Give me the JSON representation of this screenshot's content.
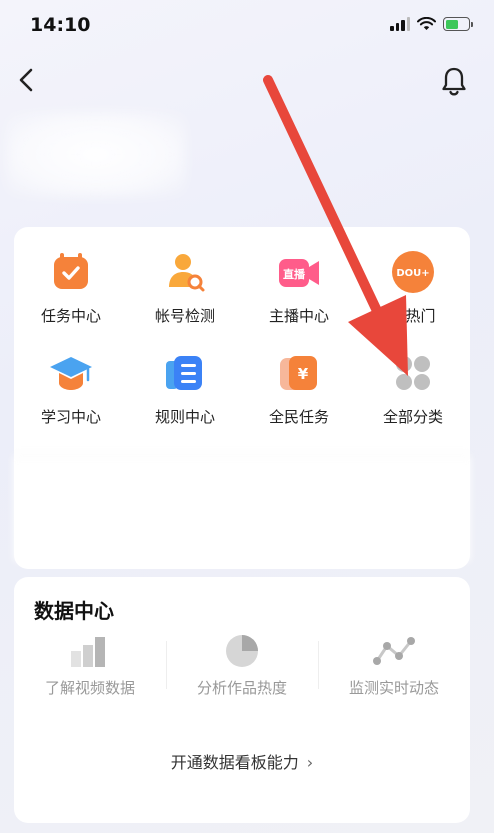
{
  "status": {
    "time": "14:10"
  },
  "services": {
    "items": [
      {
        "label": "任务中心",
        "icon": "task-icon"
      },
      {
        "label": "帐号检测",
        "icon": "account-check-icon"
      },
      {
        "label": "主播中心",
        "icon": "streamer-icon",
        "badge": "直播"
      },
      {
        "label": "上热门",
        "icon": "dou-plus-icon",
        "badge": "DOU+"
      },
      {
        "label": "学习中心",
        "icon": "graduation-cap-icon"
      },
      {
        "label": "规则中心",
        "icon": "rules-icon"
      },
      {
        "label": "全民任务",
        "icon": "yuan-task-icon",
        "badge": "¥"
      },
      {
        "label": "全部分类",
        "icon": "all-categories-icon"
      }
    ]
  },
  "data_center": {
    "title": "数据中心",
    "items": [
      {
        "label": "了解视频数据",
        "icon": "bar-chart-icon"
      },
      {
        "label": "分析作品热度",
        "icon": "pie-chart-icon"
      },
      {
        "label": "监测实时动态",
        "icon": "line-chart-icon"
      }
    ],
    "open_label": "开通数据看板能力",
    "open_chevron": "›"
  },
  "colors": {
    "accent_orange": "#f5823a",
    "arrow_red": "#e8473b",
    "battery_green": "#3cc75a"
  }
}
